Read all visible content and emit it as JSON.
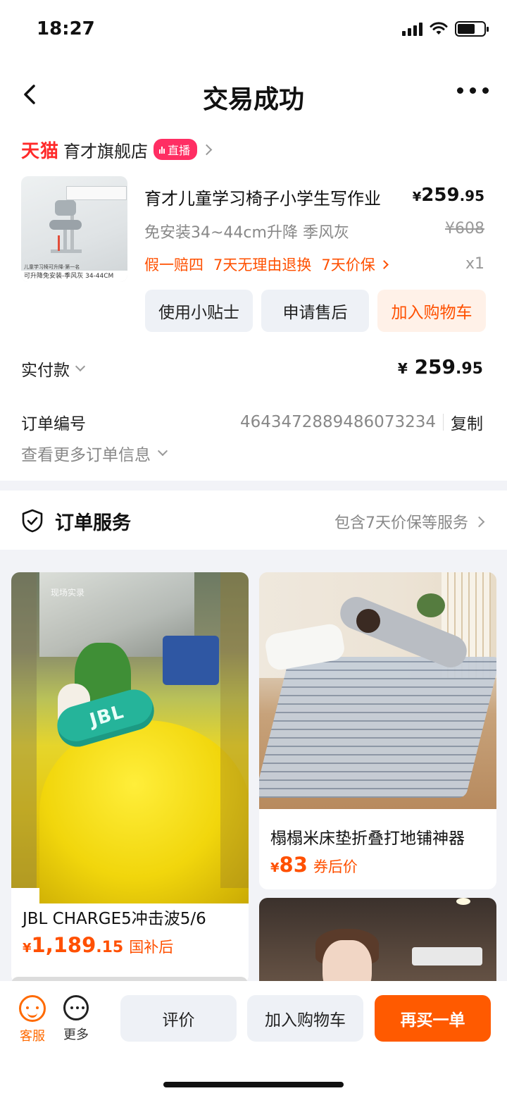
{
  "status_bar": {
    "time": "18:27"
  },
  "nav": {
    "title": "交易成功"
  },
  "shop": {
    "platform": "天猫",
    "name": "育才旗舰店",
    "live_badge": "直播"
  },
  "product": {
    "title": "育才儿童学习椅子小学生写作业",
    "price_symbol": "¥",
    "price_int": "259",
    "price_dec": ".95",
    "sku": "免安装34~44cm升降 季风灰",
    "original_price": "¥608",
    "guarantees": [
      "假一赔四",
      "7天无理由退换",
      "7天价保"
    ],
    "quantity": "x1",
    "image_caption_small": "儿童学习椅可升降·第一名",
    "image_caption": "可升降免安装-季风灰 34-44CM"
  },
  "actions": {
    "tips": "使用小贴士",
    "after_sale": "申请售后",
    "add_cart": "加入购物车"
  },
  "payment": {
    "label": "实付款",
    "symbol": "¥",
    "amount_int": "259",
    "amount_dec": ".95"
  },
  "order": {
    "label": "订单编号",
    "number": "4643472889486073234",
    "copy": "复制",
    "more_info": "查看更多订单信息"
  },
  "service": {
    "title": "订单服务",
    "desc": "包含7天价保等服务"
  },
  "recommendations": [
    {
      "title": "JBL CHARGE5冲击波5/6",
      "symbol": "¥",
      "price_int": "1,189",
      "price_dec": ".15",
      "tag": "国补后",
      "watermark": "现场实录"
    },
    {
      "title": "榻榻米床垫折叠打地铺神器",
      "symbol": "¥",
      "price_int": "83",
      "price_dec": "",
      "tag": "券后价"
    },
    {
      "title": "",
      "symbol": "",
      "price_int": "",
      "price_dec": "",
      "tag": ""
    }
  ],
  "bottom_bar": {
    "kefu": "客服",
    "more": "更多",
    "review": "评价",
    "add_cart": "加入购物车",
    "rebuy": "再买一单"
  },
  "colors": {
    "accent": "#ff5000",
    "tmall_red": "#ff2a2a",
    "live_pink": "#ff2e63",
    "button_bg": "#eef1f6"
  },
  "icons": [
    "signal-icon",
    "wifi-icon",
    "battery-icon",
    "back-icon",
    "more-icon",
    "shield-icon",
    "customer-service-icon",
    "more-circle-icon"
  ]
}
